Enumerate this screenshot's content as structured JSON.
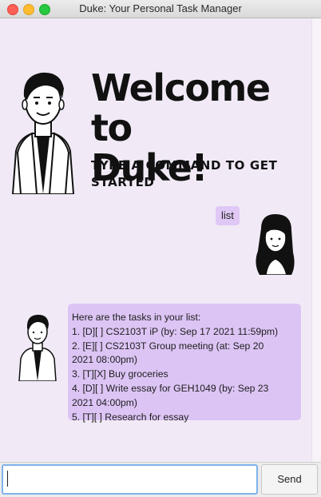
{
  "window": {
    "title": "Duke: Your Personal Task Manager"
  },
  "welcome": {
    "title_line1": "Welcome to",
    "title_line2": "Duke!",
    "subtitle": "TYPE A COMMAND TO GET STARTED"
  },
  "conversation": {
    "user_message": "list",
    "duke_reply": [
      "Here are the tasks in your list:",
      "1. [D][ ] CS2103T iP (by: Sep 17 2021 11:59pm)",
      "2. [E][ ] CS2103T Group meeting (at: Sep 20",
      "2021 08:00pm)",
      "3. [T][X] Buy groceries",
      "4. [D][ ] Write essay for GEH1049 (by: Sep 23",
      "2021 04:00pm)",
      "5. [T][ ] Research for essay"
    ]
  },
  "input_bar": {
    "value": "",
    "placeholder": "",
    "send_label": "Send"
  },
  "colors": {
    "background": "#f1eaf6",
    "bubble": "#dcc4f4",
    "input_focus": "#7eb3ea"
  }
}
